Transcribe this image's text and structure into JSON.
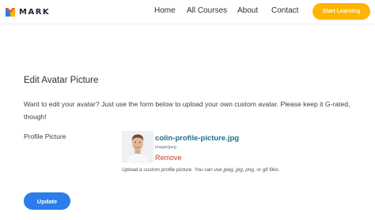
{
  "header": {
    "logo_text": "MARK",
    "nav": [
      "Home",
      "All Courses",
      "About",
      "Contact"
    ],
    "cta_label": "Start Learning",
    "cta_color": "#ffb400"
  },
  "form": {
    "title": "Edit Avatar Picture",
    "description": "Want to edit your avatar? Just use the form below to upload your own custom avatar. Please keep it G-rated, though!",
    "field_label": "Profile Picture",
    "file": {
      "name": "colin-profile-picture.jpg",
      "type": "image/jpeg",
      "remove_label": "Remove"
    },
    "hint": "Upload a custom profile picture. You can use jpeg, jpg, png, or gif files.",
    "submit_label": "Update",
    "submit_color": "#2b7de9"
  },
  "icons": {
    "logo": "mark-logo-icon",
    "avatar": "profile-photo"
  }
}
